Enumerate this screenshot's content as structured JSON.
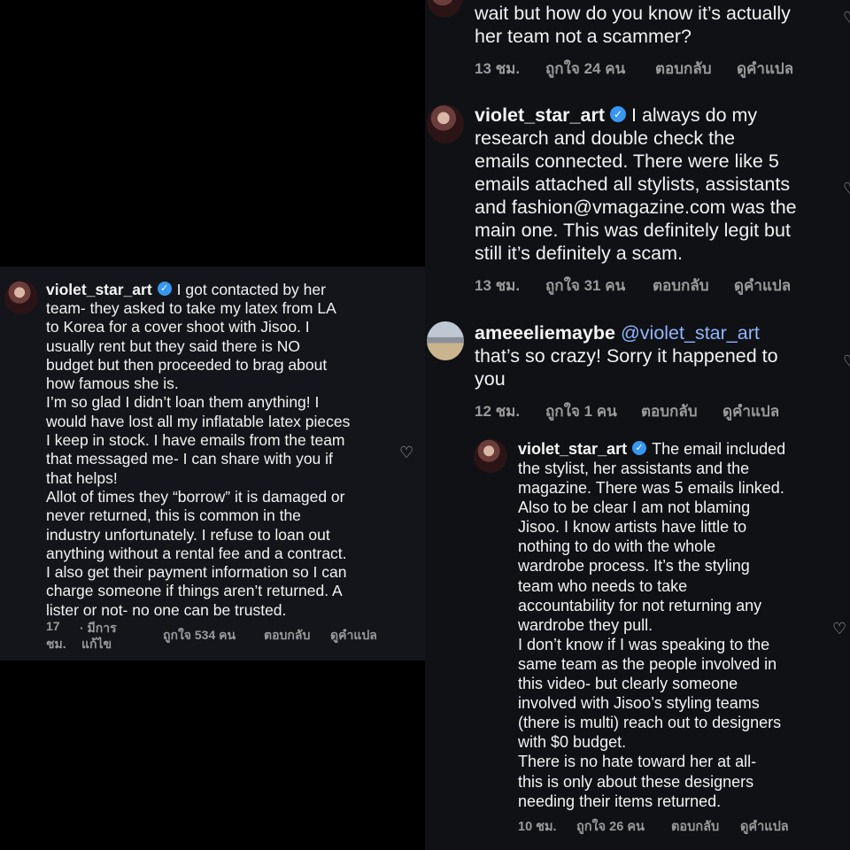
{
  "left_comment": {
    "username": "violet_star_art",
    "verified_mark": "✓",
    "text_lines": [
      "I got contacted by her",
      "team- they asked to take my latex from LA",
      "to Korea for a cover shoot with Jisoo. I",
      "usually rent but they said there is NO",
      "budget but then proceeded to brag about",
      "how famous she is.",
      "I’m so glad I didn’t loan them anything! I",
      "would have lost all my inflatable latex pieces",
      "I keep in stock. I have emails from the team",
      "that messaged me- I can share with you if",
      "that helps!",
      "Allot of times they “borrow” it is damaged or",
      "never returned, this is common in the",
      "industry unfortunately. I refuse to loan out",
      "anything without a rental fee and a contract.",
      "I also get their payment information so I can",
      "charge someone if things aren’t returned. A",
      "lister or not- no one can be trusted."
    ],
    "time_line1": "17",
    "time_line2": "ชม.",
    "edited_line1": "· มีการ",
    "edited_line2": "แก้ไข",
    "likes": "ถูกใจ 534 คน",
    "reply": "ตอบกลับ",
    "translate": "ดูคำแปล",
    "heart_icon": "♡"
  },
  "right_comments": [
    {
      "id": "c1",
      "text_lines": [
        "wait but how do you know it’s actually",
        "her team not a scammer?"
      ],
      "time": "13 ชม.",
      "likes": "ถูกใจ 24 คน",
      "reply": "ตอบกลับ",
      "translate": "ดูคำแปล"
    },
    {
      "id": "c2",
      "username": "violet_star_art",
      "verified_mark": "✓",
      "first_line": "I always do my",
      "text_lines": [
        "research and double check the",
        "emails connected. There were like 5",
        "emails attached all stylists, assistants",
        "and fashion@vmagazine.com was the",
        "main one. This was definitely legit but",
        "still it’s definitely a scam."
      ],
      "time": "13 ชม.",
      "likes": "ถูกใจ 31 คน",
      "reply": "ตอบกลับ",
      "translate": "ดูคำแปล"
    },
    {
      "id": "c3",
      "username": "ameeeliemaybe",
      "mention": "@violet_star_art",
      "text_lines": [
        "that’s so crazy! Sorry it happened to",
        "you"
      ],
      "time": "12 ชม.",
      "likes": "ถูกใจ 1 คน",
      "reply": "ตอบกลับ",
      "translate": "ดูคำแปล"
    },
    {
      "id": "c4",
      "username": "violet_star_art",
      "verified_mark": "✓",
      "first_line": "The email included",
      "text_lines": [
        "the stylist, her assistants and the",
        "magazine. There was 5 emails linked.",
        "Also to be clear I am not blaming",
        "Jisoo. I know artists have little to",
        "nothing to do with the whole",
        "wardrobe process. It’s the styling",
        "team who needs to take",
        "accountability for not returning any",
        "wardrobe they pull.",
        "I don’t know if I was speaking to the",
        "same team as the people involved in",
        "this video- but clearly someone",
        "involved with Jisoo’s styling teams",
        "(there is multi) reach out to designers",
        "with $0 budget.",
        "There is no hate toward her at all-",
        "this is only about these designers",
        "needing their items returned."
      ],
      "time": "10 ชม.",
      "likes": "ถูกใจ 26 คน",
      "reply": "ตอบกลับ",
      "translate": "ดูคำแปล"
    }
  ]
}
